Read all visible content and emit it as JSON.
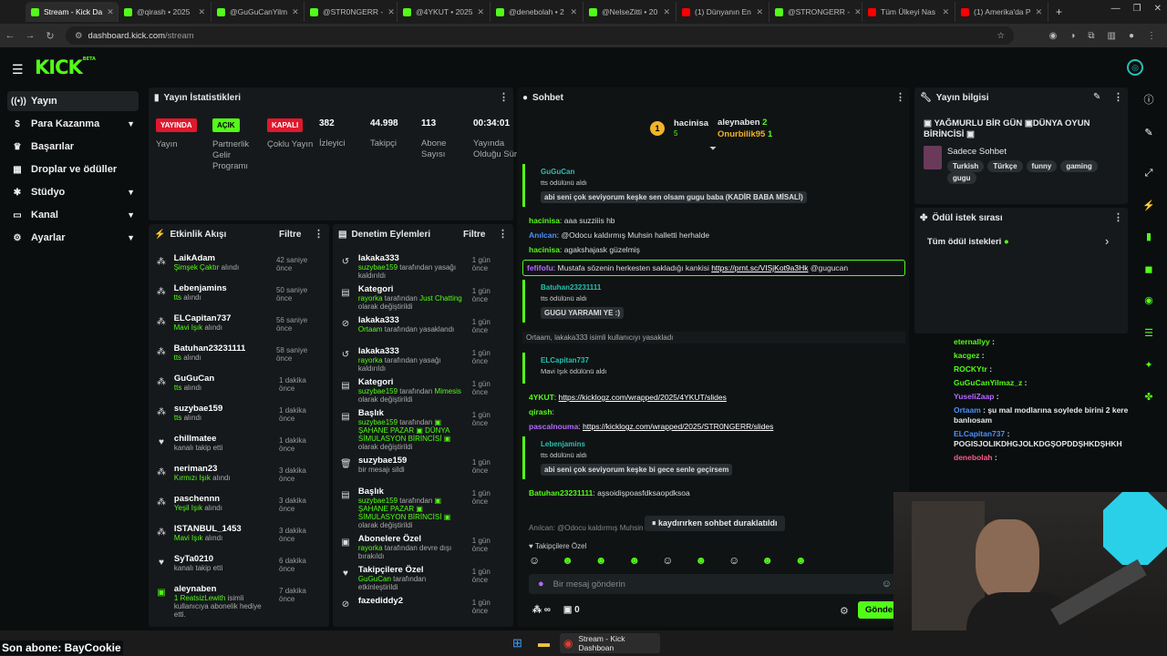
{
  "browser": {
    "tabs": [
      {
        "label": "Stream - Kick Da",
        "color": "#53fc18",
        "active": true
      },
      {
        "label": "@qirash • 2025",
        "color": "#53fc18"
      },
      {
        "label": "@GuGuCanYilm",
        "color": "#53fc18"
      },
      {
        "label": "@STR0NGERR -",
        "color": "#53fc18"
      },
      {
        "label": "@4YKUT • 2025",
        "color": "#53fc18"
      },
      {
        "label": "@denebolah • 2",
        "color": "#53fc18"
      },
      {
        "label": "@NelseZitti • 20",
        "color": "#53fc18"
      },
      {
        "label": "(1) Dünyanın En",
        "color": "#ff0000"
      },
      {
        "label": "@STRONGERR -",
        "color": "#53fc18"
      },
      {
        "label": "Tüm Ülkeyi Nas",
        "color": "#ff0000"
      },
      {
        "label": "(1) Amerika'da P",
        "color": "#ff0000"
      }
    ],
    "new_tab": "+",
    "url_domain": "dashboard.kick.com",
    "url_path": "/stream"
  },
  "header": {
    "logo": "KICK",
    "logo_beta": "BETA"
  },
  "sidebar": {
    "items": [
      {
        "label": "Yayın",
        "icon": "broadcast-icon",
        "active": true
      },
      {
        "label": "Para Kazanma",
        "icon": "dollar-icon",
        "chevron": true
      },
      {
        "label": "Başarılar",
        "icon": "trophy-icon"
      },
      {
        "label": "Droplar ve ödüller",
        "icon": "gift-icon"
      },
      {
        "label": "Stüdyo",
        "icon": "studio-icon",
        "chevron": true
      },
      {
        "label": "Kanal",
        "icon": "channel-icon",
        "chevron": true
      },
      {
        "label": "Ayarlar",
        "icon": "gear-icon",
        "chevron": true
      }
    ]
  },
  "stats": {
    "title": "Yayın İstatistikleri",
    "items": [
      {
        "badge": "YAYINDA",
        "badge_color": "#e0182d",
        "label": "Yayın"
      },
      {
        "badge": "AÇIK",
        "badge_color": "#53fc18",
        "label": "Partnerlik Gelir Programı"
      },
      {
        "badge": "KAPALI",
        "badge_color": "#e0182d",
        "label": "Çoklu Yayın"
      },
      {
        "value": "382",
        "label": "İzleyici"
      },
      {
        "value": "44.998",
        "label": "Takipçi"
      },
      {
        "value": "113",
        "label": "Abone Sayısı"
      },
      {
        "value": "00:34:01",
        "label": "Yayında Olduğu Süre"
      }
    ]
  },
  "activity": {
    "title": "Etkinlik Akışı",
    "filter": "Filtre",
    "items": [
      {
        "name": "LaikAdam",
        "sub_hl": "Şimşek Çaktır",
        "sub": " alındı",
        "time": "42 saniye önce",
        "icon": "gift-icon"
      },
      {
        "name": "Lebenjamins",
        "sub_hl": "tts",
        "sub": " alındı",
        "time": "50 saniye önce",
        "icon": "gift-icon"
      },
      {
        "name": "ELCapitan737",
        "sub_hl": "Mavi Işık",
        "sub": " alındı",
        "time": "56 saniye önce",
        "icon": "gift-icon"
      },
      {
        "name": "Batuhan23231111",
        "sub_hl": "tts",
        "sub": " alındı",
        "time": "58 saniye önce",
        "icon": "gift-icon"
      },
      {
        "name": "GuGuCan",
        "sub_hl": "tts",
        "sub": " alındı",
        "time": "1 dakika önce",
        "icon": "gift-icon"
      },
      {
        "name": "suzybae159",
        "sub_hl": "tts",
        "sub": " alındı",
        "time": "1 dakika önce",
        "icon": "gift-icon"
      },
      {
        "name": "chillmatee",
        "sub_hl": "",
        "sub": "kanalı takip etti",
        "time": "1 dakika önce",
        "icon": "heart-icon"
      },
      {
        "name": "neriman23",
        "sub_hl": "Kırmızı Işık",
        "sub": " alındı",
        "time": "3 dakika önce",
        "icon": "gift-icon"
      },
      {
        "name": "paschennn",
        "sub_hl": "Yeşil Işık",
        "sub": " alındı",
        "time": "3 dakika önce",
        "icon": "gift-icon"
      },
      {
        "name": "ISTANBUL_1453",
        "sub_hl": "Mavi Işık",
        "sub": " alındı",
        "time": "3 dakika önce",
        "icon": "gift-icon"
      },
      {
        "name": "SyTa0210",
        "sub_hl": "",
        "sub": "kanalı takip etti",
        "time": "6 dakika önce",
        "icon": "heart-icon"
      },
      {
        "name": "aleynaben",
        "sub_hl": "1 ReatsizLewith",
        "sub": " isimli kullanıcıya abonelik hediye etti.",
        "time": "7 dakika önce",
        "icon": "sub-gift-icon"
      }
    ]
  },
  "moderation": {
    "title": "Denetim Eylemleri",
    "filter": "Filtre",
    "items": [
      {
        "name": "lakaka333",
        "actor": "suzybae159",
        "text": " tarafından yasağı kaldırıldı",
        "time": "1 gün önce",
        "icon": "unban-icon"
      },
      {
        "name": "Kategori",
        "actor": "rayorka",
        "text": " tarafından ",
        "hl2": "Just Chatting",
        "text2": " olarak değiştirildi",
        "time": "1 gün önce",
        "icon": "category-icon"
      },
      {
        "name": "lakaka333",
        "actor": "Ortaam",
        "text": " tarafından yasaklandı",
        "time": "1 gün önce",
        "icon": "ban-icon"
      },
      {
        "name": "lakaka333",
        "actor": "rayorka",
        "text": " tarafından yasağı kaldırıldı",
        "time": "1 gün önce",
        "icon": "unban-icon"
      },
      {
        "name": "Kategori",
        "actor": "suzybae159",
        "text": " tarafından ",
        "hl2": "Mimesis",
        "text2": " olarak değiştirildi",
        "time": "1 gün önce",
        "icon": "category-icon"
      },
      {
        "name": "Başlık",
        "actor": "suzybae159",
        "text": " tarafından ",
        "hl2": "▣ ŞAHANE PAZAR ▣ DÜNYA SİMULASYON BİRİNCİSİ ▣",
        "text2": " olarak değiştirildi",
        "time": "1 gün önce",
        "icon": "title-icon"
      },
      {
        "name": "suzybae159",
        "actor": "",
        "text": "bir mesajı sildi",
        "time": "1 gün önce",
        "icon": "trash-icon"
      },
      {
        "name": "Başlık",
        "actor": "suzybae159",
        "text": " tarafından ",
        "hl2": "▣ ŞAHANE PAZAR ▣ SİMULASYON BİRİNCİSİ ▣",
        "text2": " olarak değiştirildi",
        "time": "1 gün önce",
        "icon": "title-icon"
      },
      {
        "name": "Abonelere Özel",
        "actor": "rayorka",
        "text": " tarafından devre dışı bırakıldı",
        "time": "1 gün önce",
        "icon": "sub-icon"
      },
      {
        "name": "Takipçilere Özel",
        "actor": "GuGuCan",
        "text": " tarafından etkinleştirildi",
        "time": "1 gün önce",
        "icon": "heart-icon"
      },
      {
        "name": "fazediddy2",
        "actor": "",
        "text": "",
        "time": "1 gün önce",
        "icon": "ban-icon"
      }
    ]
  },
  "chat": {
    "title": "Sohbet",
    "top_gifters": [
      {
        "rank": "1",
        "name": "hacinisa",
        "count": "5"
      },
      {
        "name": "aleynaben",
        "count": "2"
      },
      {
        "name": "Onurbilik95",
        "count": "1"
      }
    ],
    "messages": [
      {
        "type": "tts",
        "user": "GuGuCan",
        "reward": "tts ödülünü aldı",
        "text": "abi seni çok seviyorum keşke sen olsam gugu baba (KADİR BABA MİSALİ)"
      },
      {
        "type": "msg",
        "user": "hacinisa",
        "color": "#53fc18",
        "text": "aaa suzziiis hb"
      },
      {
        "type": "msg",
        "user": "Anılcan",
        "color": "#4a90ff",
        "text": "@Odocu kaldırmış Muhsin halletti herhalde"
      },
      {
        "type": "msg",
        "user": "hacinisa",
        "color": "#53fc18",
        "text": "agakshajask güzelmiş"
      },
      {
        "type": "highlight",
        "user": "fefifofu",
        "pre": "Mustafa sözenin herkesten sakladığı kankisi ",
        "link": "https://prnt.sc/VISjKot9a3Hk",
        "post": " @gugucan"
      },
      {
        "type": "tts",
        "user": "Batuhan23231111",
        "reward": "tts ödülünü aldı",
        "text": "GUGU YARRAMI YE :)"
      },
      {
        "type": "sys",
        "text": "Ortaam, lakaka333 isimli kullanıcıyı yasakladı"
      },
      {
        "type": "tts",
        "user": "ELCapitan737",
        "reward": "Mavi Işık ödülünü aldı",
        "text": ""
      },
      {
        "type": "link",
        "user": "4YKUT",
        "color": "#53fc18",
        "link": "https://kicklogz.com/wrapped/2025/4YKUT/slides"
      },
      {
        "type": "msg",
        "user": "qirash",
        "color": "#53fc18",
        "text": ""
      },
      {
        "type": "link",
        "user": "pascalnouma",
        "color": "#b36bff",
        "link": "https://kicklogz.com/wrapped/2025/STR0NGERR/slides"
      },
      {
        "type": "tts",
        "user": "Lebenjamins",
        "reward": "tts ödülünü aldı",
        "text": "abi seni çok seviyorum keşke bi gece senle geçirsem"
      },
      {
        "type": "msg",
        "user": "Batuhan23231111",
        "color": "#53fc18",
        "text": "aşsoidişpoasfdksaopdksoa"
      }
    ],
    "reply_hint": "Anılcan: @Odocu kaldırmış Muhsin halletti herhalde",
    "paused": "kaydırırken sohbet duraklatıldı",
    "followers_only": "Takipçilere Özel",
    "input_placeholder": "Bir mesaj gönderin",
    "points": "∞",
    "chest_count": "0",
    "send": "Gönder"
  },
  "stream_info": {
    "title": "Yayın bilgisi",
    "stream_title": "▣ YAĞMURLU BİR GÜN ▣DÜNYA OYUN BİRİNCİSİ ▣",
    "category": "Sadece Sohbet",
    "tags": [
      "Turkish",
      "Türkçe",
      "funny",
      "gaming",
      "gugu"
    ]
  },
  "rewards": {
    "title": "Ödül istek sırası",
    "all": "Tüm ödül istekleri"
  },
  "overlay_chat": [
    {
      "user": "eternallyy",
      "color": "#53fc18",
      "text": ""
    },
    {
      "user": "kacgez",
      "color": "#53fc18",
      "text": ""
    },
    {
      "user": "ROCKYtr",
      "color": "#53fc18",
      "text": ""
    },
    {
      "user": "GuGuCanYilmaz_z",
      "color": "#53fc18",
      "text": ""
    },
    {
      "user": "YuseliZaap",
      "color": "#b36bff",
      "text": ""
    },
    {
      "user": "Ortaam",
      "color": "#4a90ff",
      "text": "şu mal modlarına soylede birini 2 kere banlıosam"
    },
    {
      "user": "ELCapitan737",
      "color": "#4a90ff",
      "text": "POGISJOLIKDHGJOLKDGŞOPDDŞHKDŞHKH"
    },
    {
      "user": "denebolah",
      "color": "#ff5a8a",
      "text": ""
    }
  ],
  "last_sub": "Son abone: BayCookie",
  "taskbar": {
    "window_label": "Stream - Kick Dashboan"
  }
}
